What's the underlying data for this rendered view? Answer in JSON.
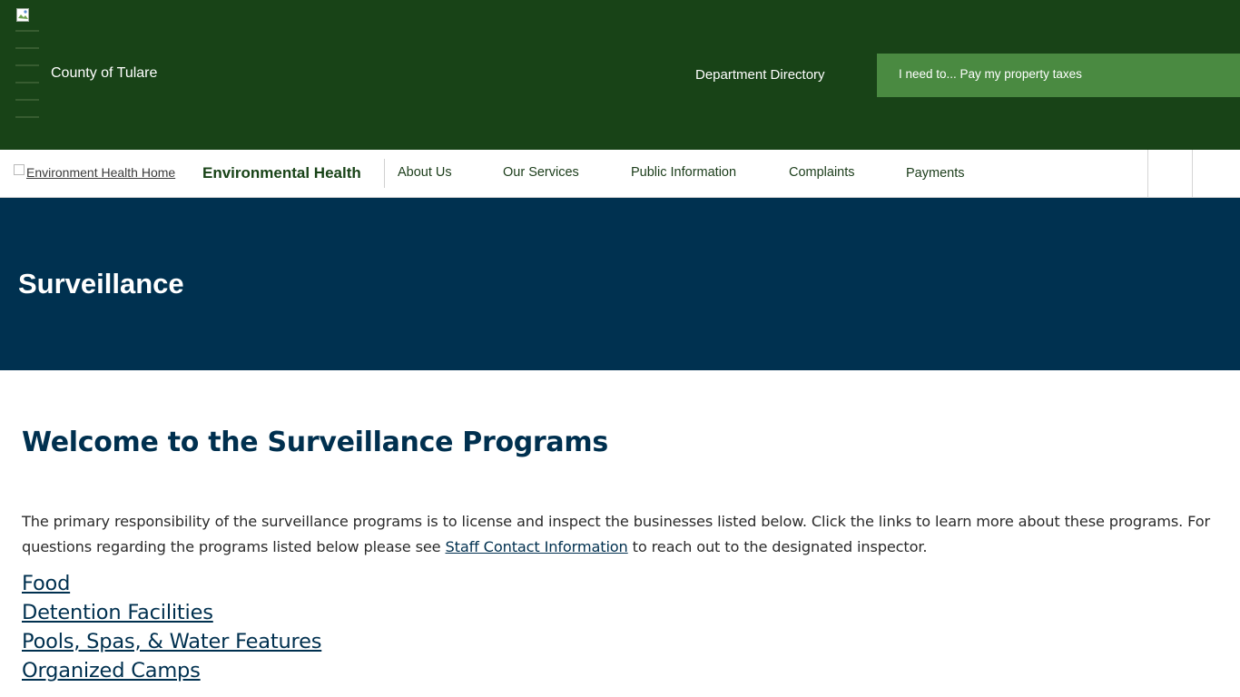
{
  "header": {
    "county_name": "County of Tulare",
    "department_directory": "Department Directory",
    "i_need_to": "I need to... Pay my property taxes",
    "background_color": "#184317",
    "cta_color": "#4a8a41"
  },
  "nav": {
    "home_image_alt": "Environment Health Home",
    "site_title": "Environmental Health",
    "items": [
      {
        "label": "About Us"
      },
      {
        "label": "Our Services"
      },
      {
        "label": "Public Information"
      },
      {
        "label": "Complaints"
      },
      {
        "label": "Payments"
      }
    ]
  },
  "banner": {
    "title": "Surveillance",
    "background_color": "#003150"
  },
  "main": {
    "heading": "Welcome to the Surveillance Programs",
    "intro_before_link": "The primary responsibility of the surveillance programs is to license and inspect the businesses listed below. Click the links to learn more about these programs. For questions regarding the programs listed below please see ",
    "intro_link": "Staff Contact Information",
    "intro_after_link": " to reach out to the designated inspector.",
    "programs": [
      {
        "label": "Food"
      },
      {
        "label": "Detention Facilities"
      },
      {
        "label": "Pools, Spas, & Water Features"
      },
      {
        "label": "Organized Camps"
      }
    ]
  }
}
